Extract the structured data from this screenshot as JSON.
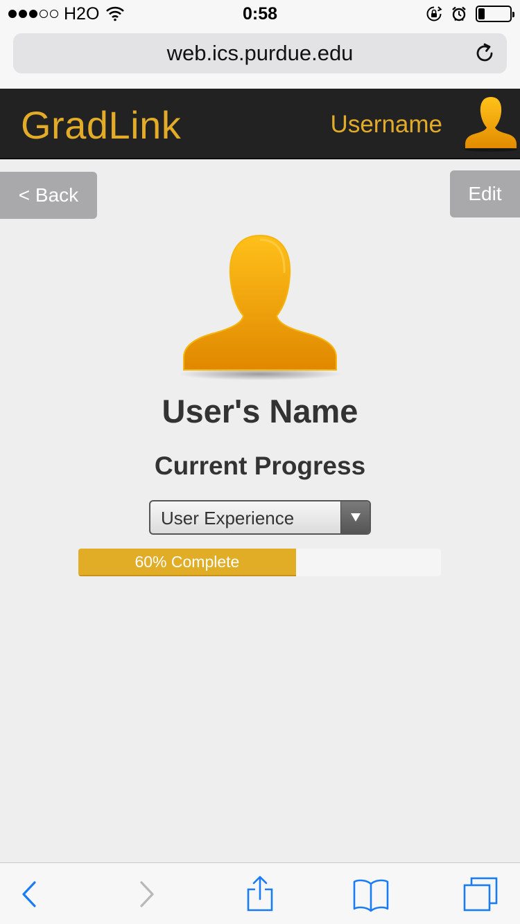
{
  "status_bar": {
    "carrier": "H2O",
    "time": "0:58",
    "battery_level": 0.2
  },
  "browser": {
    "url": "web.ics.purdue.edu"
  },
  "header": {
    "brand": "GradLink",
    "username": "Username"
  },
  "buttons": {
    "back": "< Back",
    "edit": "Edit"
  },
  "profile": {
    "name": "User's Name",
    "progress_heading": "Current Progress",
    "track_select": "User Experience",
    "progress_percent": 60,
    "progress_label": "60% Complete"
  },
  "colors": {
    "accent": "#e3ac28",
    "header_bg": "#222222",
    "button_gray": "#a9a9ab",
    "ios_blue": "#1a7cf5"
  }
}
